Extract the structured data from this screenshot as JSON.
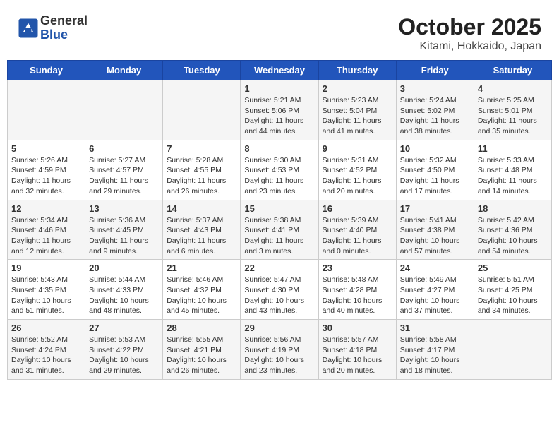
{
  "header": {
    "logo": {
      "general": "General",
      "blue": "Blue"
    },
    "title": "October 2025",
    "subtitle": "Kitami, Hokkaido, Japan"
  },
  "weekdays": [
    "Sunday",
    "Monday",
    "Tuesday",
    "Wednesday",
    "Thursday",
    "Friday",
    "Saturday"
  ],
  "weeks": [
    [
      {
        "day": "",
        "info": ""
      },
      {
        "day": "",
        "info": ""
      },
      {
        "day": "",
        "info": ""
      },
      {
        "day": "1",
        "info": "Sunrise: 5:21 AM\nSunset: 5:06 PM\nDaylight: 11 hours\nand 44 minutes."
      },
      {
        "day": "2",
        "info": "Sunrise: 5:23 AM\nSunset: 5:04 PM\nDaylight: 11 hours\nand 41 minutes."
      },
      {
        "day": "3",
        "info": "Sunrise: 5:24 AM\nSunset: 5:02 PM\nDaylight: 11 hours\nand 38 minutes."
      },
      {
        "day": "4",
        "info": "Sunrise: 5:25 AM\nSunset: 5:01 PM\nDaylight: 11 hours\nand 35 minutes."
      }
    ],
    [
      {
        "day": "5",
        "info": "Sunrise: 5:26 AM\nSunset: 4:59 PM\nDaylight: 11 hours\nand 32 minutes."
      },
      {
        "day": "6",
        "info": "Sunrise: 5:27 AM\nSunset: 4:57 PM\nDaylight: 11 hours\nand 29 minutes."
      },
      {
        "day": "7",
        "info": "Sunrise: 5:28 AM\nSunset: 4:55 PM\nDaylight: 11 hours\nand 26 minutes."
      },
      {
        "day": "8",
        "info": "Sunrise: 5:30 AM\nSunset: 4:53 PM\nDaylight: 11 hours\nand 23 minutes."
      },
      {
        "day": "9",
        "info": "Sunrise: 5:31 AM\nSunset: 4:52 PM\nDaylight: 11 hours\nand 20 minutes."
      },
      {
        "day": "10",
        "info": "Sunrise: 5:32 AM\nSunset: 4:50 PM\nDaylight: 11 hours\nand 17 minutes."
      },
      {
        "day": "11",
        "info": "Sunrise: 5:33 AM\nSunset: 4:48 PM\nDaylight: 11 hours\nand 14 minutes."
      }
    ],
    [
      {
        "day": "12",
        "info": "Sunrise: 5:34 AM\nSunset: 4:46 PM\nDaylight: 11 hours\nand 12 minutes."
      },
      {
        "day": "13",
        "info": "Sunrise: 5:36 AM\nSunset: 4:45 PM\nDaylight: 11 hours\nand 9 minutes."
      },
      {
        "day": "14",
        "info": "Sunrise: 5:37 AM\nSunset: 4:43 PM\nDaylight: 11 hours\nand 6 minutes."
      },
      {
        "day": "15",
        "info": "Sunrise: 5:38 AM\nSunset: 4:41 PM\nDaylight: 11 hours\nand 3 minutes."
      },
      {
        "day": "16",
        "info": "Sunrise: 5:39 AM\nSunset: 4:40 PM\nDaylight: 11 hours\nand 0 minutes."
      },
      {
        "day": "17",
        "info": "Sunrise: 5:41 AM\nSunset: 4:38 PM\nDaylight: 10 hours\nand 57 minutes."
      },
      {
        "day": "18",
        "info": "Sunrise: 5:42 AM\nSunset: 4:36 PM\nDaylight: 10 hours\nand 54 minutes."
      }
    ],
    [
      {
        "day": "19",
        "info": "Sunrise: 5:43 AM\nSunset: 4:35 PM\nDaylight: 10 hours\nand 51 minutes."
      },
      {
        "day": "20",
        "info": "Sunrise: 5:44 AM\nSunset: 4:33 PM\nDaylight: 10 hours\nand 48 minutes."
      },
      {
        "day": "21",
        "info": "Sunrise: 5:46 AM\nSunset: 4:32 PM\nDaylight: 10 hours\nand 45 minutes."
      },
      {
        "day": "22",
        "info": "Sunrise: 5:47 AM\nSunset: 4:30 PM\nDaylight: 10 hours\nand 43 minutes."
      },
      {
        "day": "23",
        "info": "Sunrise: 5:48 AM\nSunset: 4:28 PM\nDaylight: 10 hours\nand 40 minutes."
      },
      {
        "day": "24",
        "info": "Sunrise: 5:49 AM\nSunset: 4:27 PM\nDaylight: 10 hours\nand 37 minutes."
      },
      {
        "day": "25",
        "info": "Sunrise: 5:51 AM\nSunset: 4:25 PM\nDaylight: 10 hours\nand 34 minutes."
      }
    ],
    [
      {
        "day": "26",
        "info": "Sunrise: 5:52 AM\nSunset: 4:24 PM\nDaylight: 10 hours\nand 31 minutes."
      },
      {
        "day": "27",
        "info": "Sunrise: 5:53 AM\nSunset: 4:22 PM\nDaylight: 10 hours\nand 29 minutes."
      },
      {
        "day": "28",
        "info": "Sunrise: 5:55 AM\nSunset: 4:21 PM\nDaylight: 10 hours\nand 26 minutes."
      },
      {
        "day": "29",
        "info": "Sunrise: 5:56 AM\nSunset: 4:19 PM\nDaylight: 10 hours\nand 23 minutes."
      },
      {
        "day": "30",
        "info": "Sunrise: 5:57 AM\nSunset: 4:18 PM\nDaylight: 10 hours\nand 20 minutes."
      },
      {
        "day": "31",
        "info": "Sunrise: 5:58 AM\nSunset: 4:17 PM\nDaylight: 10 hours\nand 18 minutes."
      },
      {
        "day": "",
        "info": ""
      }
    ]
  ]
}
